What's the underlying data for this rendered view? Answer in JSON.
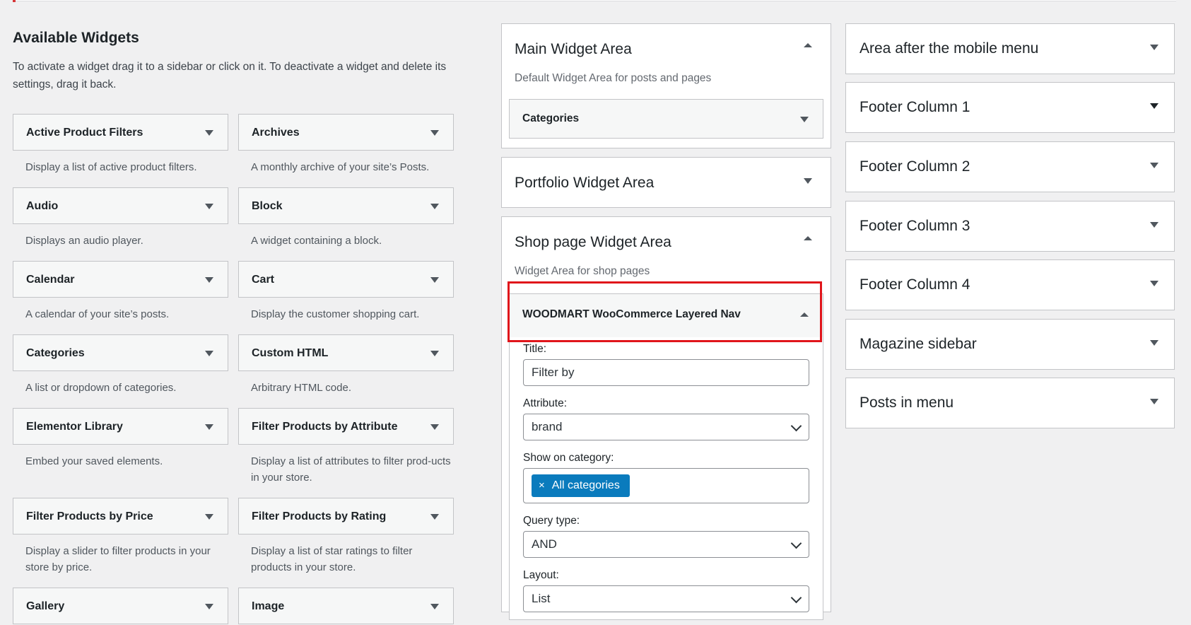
{
  "available": {
    "title": "Available Widgets",
    "hint": "To activate a widget drag it to a sidebar or click on it. To deactivate a widget and delete its settings, drag it back.",
    "left_widgets": [
      {
        "title": "Active Product Filters",
        "desc": "Display a list of active product filters."
      },
      {
        "title": "Audio",
        "desc": "Displays an audio player."
      },
      {
        "title": "Calendar",
        "desc": "A calendar of your site’s posts."
      },
      {
        "title": "Categories",
        "desc": "A list or dropdown of categories."
      },
      {
        "title": "Elementor Library",
        "desc": "Embed your saved elements."
      },
      {
        "title": "Filter Products by Price",
        "desc": "Display a slider to filter products in your store by price."
      },
      {
        "title": "Gallery",
        "desc": ""
      }
    ],
    "right_widgets": [
      {
        "title": "Archives",
        "desc": "A monthly archive of your site’s Posts."
      },
      {
        "title": "Block",
        "desc": "A widget containing a block."
      },
      {
        "title": "Cart",
        "desc": "Display the customer shopping cart."
      },
      {
        "title": "Custom HTML",
        "desc": "Arbitrary HTML code."
      },
      {
        "title": "Filter Products by Attribute",
        "desc": "Display a list of attributes to filter prod-ucts in your store."
      },
      {
        "title": "Filter Products by Rating",
        "desc": "Display a list of star ratings to filter products in your store."
      },
      {
        "title": "Image",
        "desc": ""
      }
    ]
  },
  "sidebars": {
    "main": {
      "title": "Main Widget Area",
      "desc": "Default Widget Area for posts and pages",
      "widget": "Categories"
    },
    "portfolio": {
      "title": "Portfolio Widget Area"
    },
    "shop": {
      "title": "Shop page Widget Area",
      "desc": "Widget Area for shop pages",
      "widget": "WOODMART WooCommerce Layered Nav",
      "form": {
        "title_label": "Title:",
        "title_value": "Filter by",
        "attribute_label": "Attribute:",
        "attribute_value": "brand",
        "category_label": "Show on category:",
        "category_tag": "All categories",
        "category_tag_remove": "×",
        "query_label": "Query type:",
        "query_value": "AND",
        "layout_label": "Layout:",
        "layout_value": "List"
      }
    }
  },
  "right_sidebars": [
    "Area after the mobile menu",
    "Footer Column 1",
    "Footer Column 2",
    "Footer Column 3",
    "Footer Column 4",
    "Magazine sidebar",
    "Posts in menu"
  ],
  "colors": {
    "highlight": "#e0151b",
    "tag": "#0a7bbd"
  }
}
